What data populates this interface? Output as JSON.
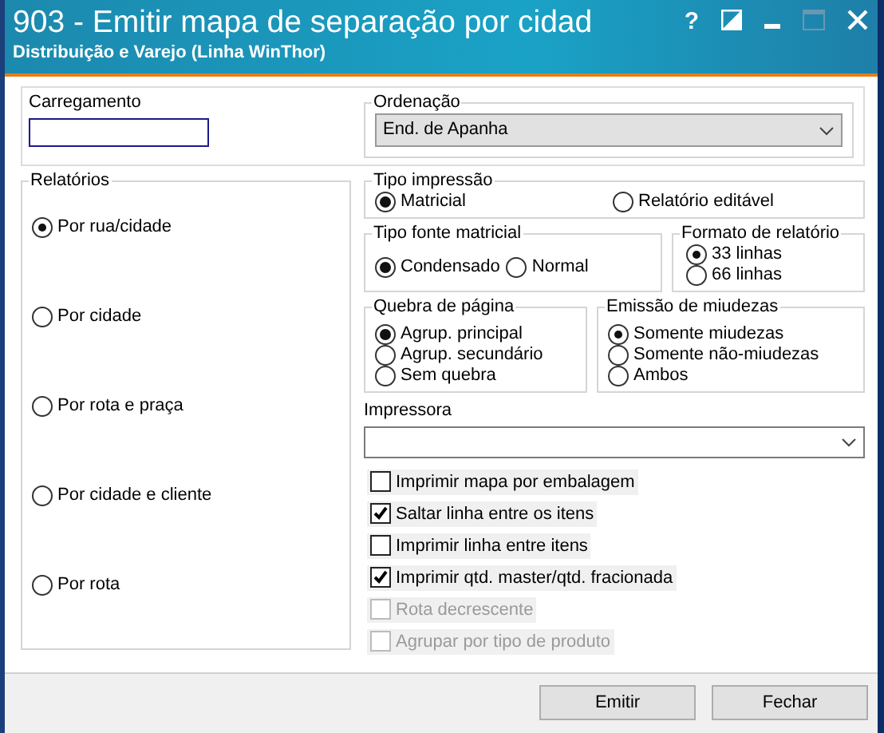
{
  "window": {
    "title": "903 - Emitir mapa de separação por cidad",
    "subtitle": "Distribuição e Varejo (Linha WinThor)",
    "help": "?"
  },
  "carregamento": {
    "label": "Carregamento"
  },
  "ordenacao": {
    "label": "Ordenação",
    "value": "End. de Apanha"
  },
  "relatorios": {
    "label": "Relatórios",
    "options": [
      {
        "label": "Por rua/cidade",
        "selected": true
      },
      {
        "label": "Por cidade",
        "selected": false
      },
      {
        "label": "Por rota e praça",
        "selected": false
      },
      {
        "label": "Por cidade e cliente",
        "selected": false
      },
      {
        "label": "Por rota",
        "selected": false
      }
    ]
  },
  "tipo_impressao": {
    "label": "Tipo impressão",
    "options": [
      {
        "label": "Matricial",
        "selected": true
      },
      {
        "label": "Relatório editável",
        "selected": false
      }
    ]
  },
  "tipo_fonte": {
    "label": "Tipo fonte matricial",
    "options": [
      {
        "label": "Condensado",
        "selected": true
      },
      {
        "label": "Normal",
        "selected": false
      }
    ]
  },
  "formato": {
    "label": "Formato de relatório",
    "options": [
      {
        "label": "33 linhas",
        "selected": true
      },
      {
        "label": "66 linhas",
        "selected": false
      }
    ]
  },
  "quebra": {
    "label": "Quebra de página",
    "options": [
      {
        "label": "Agrup. principal",
        "selected": true
      },
      {
        "label": "Agrup. secundário",
        "selected": false
      },
      {
        "label": "Sem quebra",
        "selected": false
      }
    ]
  },
  "miudezas": {
    "label": "Emissão de miudezas",
    "options": [
      {
        "label": "Somente miudezas",
        "selected": true
      },
      {
        "label": "Somente não-miudezas",
        "selected": false
      },
      {
        "label": "Ambos",
        "selected": false
      }
    ]
  },
  "impressora": {
    "label": "Impressora"
  },
  "options": [
    {
      "label": "Imprimir mapa por embalagem",
      "checked": false,
      "disabled": false
    },
    {
      "label": "Saltar linha entre os itens",
      "checked": true,
      "disabled": false
    },
    {
      "label": "Imprimir linha entre itens",
      "checked": false,
      "disabled": false
    },
    {
      "label": "Imprimir qtd. master/qtd. fracionada",
      "checked": true,
      "disabled": false
    },
    {
      "label": "Rota decrescente",
      "checked": false,
      "disabled": true
    },
    {
      "label": "Agrupar por tipo de produto",
      "checked": false,
      "disabled": true
    }
  ],
  "buttons": [
    "Emitir",
    "Fechar"
  ]
}
